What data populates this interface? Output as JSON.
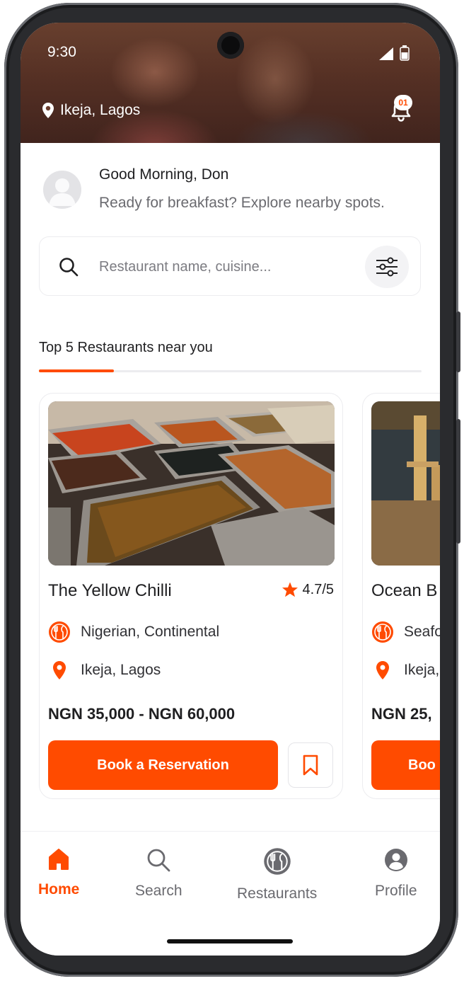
{
  "status": {
    "time": "9:30"
  },
  "header": {
    "location": "Ikeja, Lagos",
    "notification_count": "01"
  },
  "greeting": {
    "title": "Good Morning, Don",
    "subtitle": "Ready for breakfast? Explore nearby spots."
  },
  "search": {
    "placeholder": "Restaurant name, cuisine..."
  },
  "section": {
    "title": "Top 5 Restaurants near you"
  },
  "restaurants": [
    {
      "name": "The Yellow Chilli",
      "rating": "4.7/5",
      "cuisine": "Nigerian, Continental",
      "location": "Ikeja, Lagos",
      "price": "NGN 35,000 - NGN 60,000",
      "book_label": "Book a Reservation"
    },
    {
      "name": "Ocean B",
      "cuisine": "Seafo",
      "location": "Ikeja,",
      "price": "NGN 25,",
      "book_label": "Boo"
    }
  ],
  "nav": [
    {
      "label": "Home",
      "icon": "home-icon",
      "active": true
    },
    {
      "label": "Search",
      "icon": "search-icon",
      "active": false
    },
    {
      "label": "Restaurants",
      "icon": "cutlery-icon",
      "active": false
    },
    {
      "label": "Profile",
      "icon": "profile-icon",
      "active": false
    }
  ],
  "colors": {
    "accent": "#ff4b00",
    "text": "#1f1f21",
    "muted": "#6a6a6f"
  }
}
